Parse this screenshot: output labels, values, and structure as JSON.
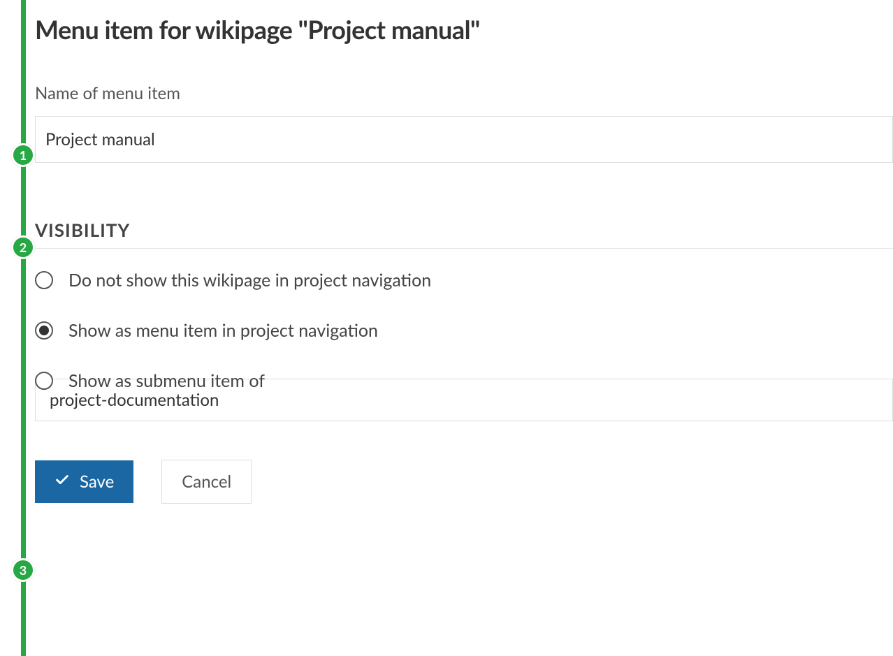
{
  "page_title": "Menu item for wikipage \"Project manual\"",
  "name_field": {
    "label": "Name of menu item",
    "value": "Project manual"
  },
  "visibility": {
    "heading": "VISIBILITY",
    "options": [
      {
        "label": "Do not show this wikipage in project navigation",
        "selected": false
      },
      {
        "label": "Show as menu item in project navigation",
        "selected": true
      },
      {
        "label": "Show as submenu item of",
        "selected": false
      }
    ],
    "submenu_select_value": "project-documentation"
  },
  "buttons": {
    "save": "Save",
    "cancel": "Cancel"
  },
  "step_markers": {
    "one": "1",
    "two": "2",
    "three": "3"
  }
}
